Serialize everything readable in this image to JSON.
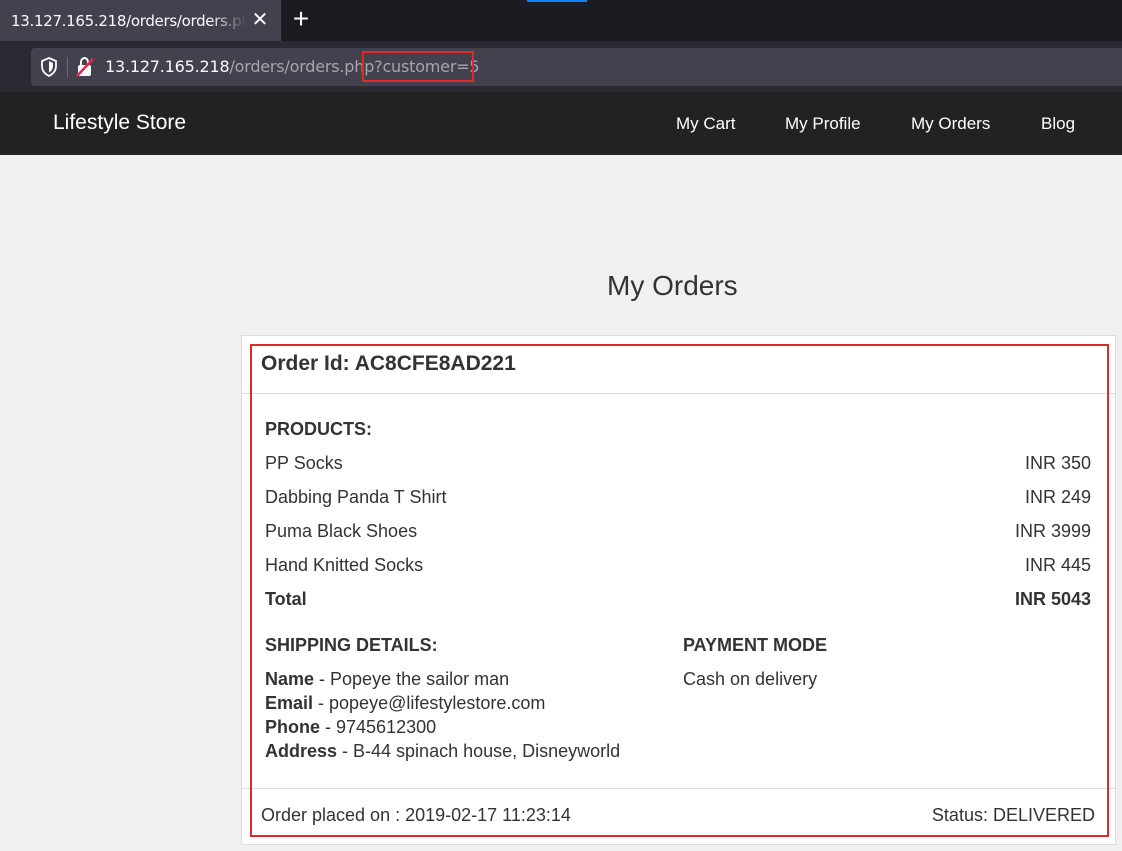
{
  "browser": {
    "tab_title": "13.127.165.218/orders/orders.php?customer=5",
    "tab_close_glyph": "✕",
    "new_tab_glyph": "+",
    "url_host": "13.127.165.218",
    "url_path": "/orders/orders.php",
    "url_query": "?customer=5",
    "icons": [
      "shield-icon",
      "insecure-lock-icon",
      "close-icon",
      "plus-icon"
    ]
  },
  "header": {
    "brand": "Lifestyle Store",
    "nav": [
      "My Cart",
      "My Profile",
      "My Orders",
      "Blog"
    ]
  },
  "page": {
    "title": "My Orders"
  },
  "order": {
    "id_label": "Order Id: AC8CFE8AD221",
    "products_label": "PRODUCTS:",
    "products": [
      {
        "name": "PP Socks",
        "price": "INR 350"
      },
      {
        "name": "Dabbing Panda T Shirt",
        "price": "INR 249"
      },
      {
        "name": "Puma Black Shoes",
        "price": "INR 3999"
      },
      {
        "name": "Hand Knitted Socks",
        "price": "INR 445"
      }
    ],
    "total_label": "Total",
    "total_value": "INR 5043",
    "shipping_label": "SHIPPING DETAILS:",
    "shipping": [
      {
        "key": "Name",
        "value": " - Popeye the sailor man"
      },
      {
        "key": "Email",
        "value": " - popeye@lifestylestore.com"
      },
      {
        "key": "Phone",
        "value": " - 9745612300"
      },
      {
        "key": "Address",
        "value": " - B-44 spinach house, Disneyworld"
      }
    ],
    "payment_label": "PAYMENT MODE",
    "payment_value": "Cash on delivery",
    "placed_on": "Order placed on : 2019-02-17 11:23:14",
    "status": "Status: DELIVERED"
  },
  "colors": {
    "highlight": "#e0292a",
    "header_bg": "#222222",
    "page_bg": "#f0f0f0"
  }
}
